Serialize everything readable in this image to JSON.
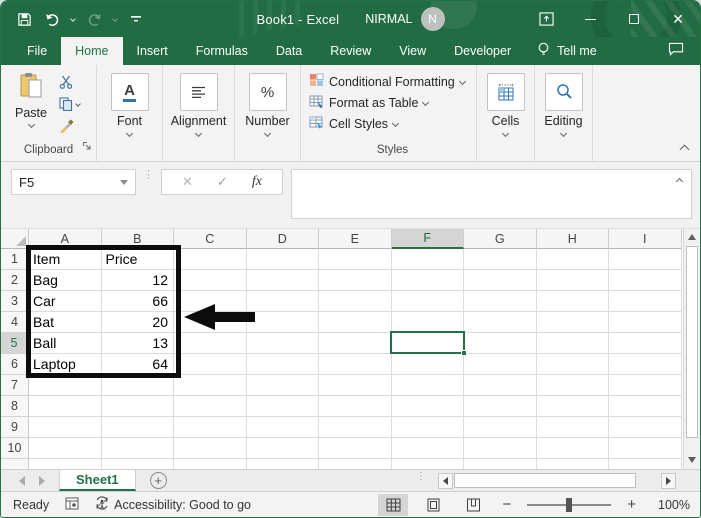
{
  "window": {
    "title": "Book1 - Excel",
    "user_name": "NIRMAL",
    "avatar_initial": "N",
    "controls": {
      "close_glyph": "✕"
    }
  },
  "menu": {
    "tabs": [
      "File",
      "Home",
      "Insert",
      "Formulas",
      "Data",
      "Review",
      "View",
      "Developer"
    ],
    "active_tab": "Home",
    "tell_me": "Tell me"
  },
  "ribbon": {
    "clipboard": {
      "paste_label": "Paste",
      "group_label": "Clipboard"
    },
    "font": {
      "icon_letter": "A",
      "group_label": "Font"
    },
    "alignment": {
      "group_label": "Alignment"
    },
    "number": {
      "icon": "%",
      "group_label": "Number"
    },
    "styles": {
      "conditional_formatting": "Conditional Formatting",
      "format_as_table": "Format as Table",
      "cell_styles": "Cell Styles",
      "group_label": "Styles"
    },
    "cells": {
      "group_label": "Cells"
    },
    "editing": {
      "group_label": "Editing"
    }
  },
  "formula_bar": {
    "name_box_value": "F5",
    "cancel_glyph": "✕",
    "enter_glyph": "✓",
    "fx_label": "fx",
    "formula_value": ""
  },
  "spreadsheet": {
    "columns": [
      "A",
      "B",
      "C",
      "D",
      "E",
      "F",
      "G",
      "H",
      "I"
    ],
    "row_count": 10,
    "cells": {
      "A1": "Item",
      "B1": "Price",
      "A2": "Bag",
      "B2": 12,
      "A3": "Car",
      "B3": 66,
      "A4": "Bat",
      "B4": 20,
      "A5": "Ball",
      "B5": 13,
      "A6": "Laptop",
      "B6": 64
    },
    "selected_cell": "F5",
    "highlighted_column": "F",
    "highlighted_row": 5,
    "outlined_range": "A1:B6"
  },
  "sheet_tabs": {
    "active_tab": "Sheet1",
    "add_glyph": "+"
  },
  "status_bar": {
    "mode": "Ready",
    "accessibility": "Accessibility: Good to go",
    "zoom_minus": "−",
    "zoom_plus": "+",
    "zoom_level": "100%"
  },
  "colors": {
    "brand_green": "#217346",
    "titlebar_green": "#226C44",
    "selection_green": "#217346",
    "annotation_black": "#0c0c0c"
  }
}
